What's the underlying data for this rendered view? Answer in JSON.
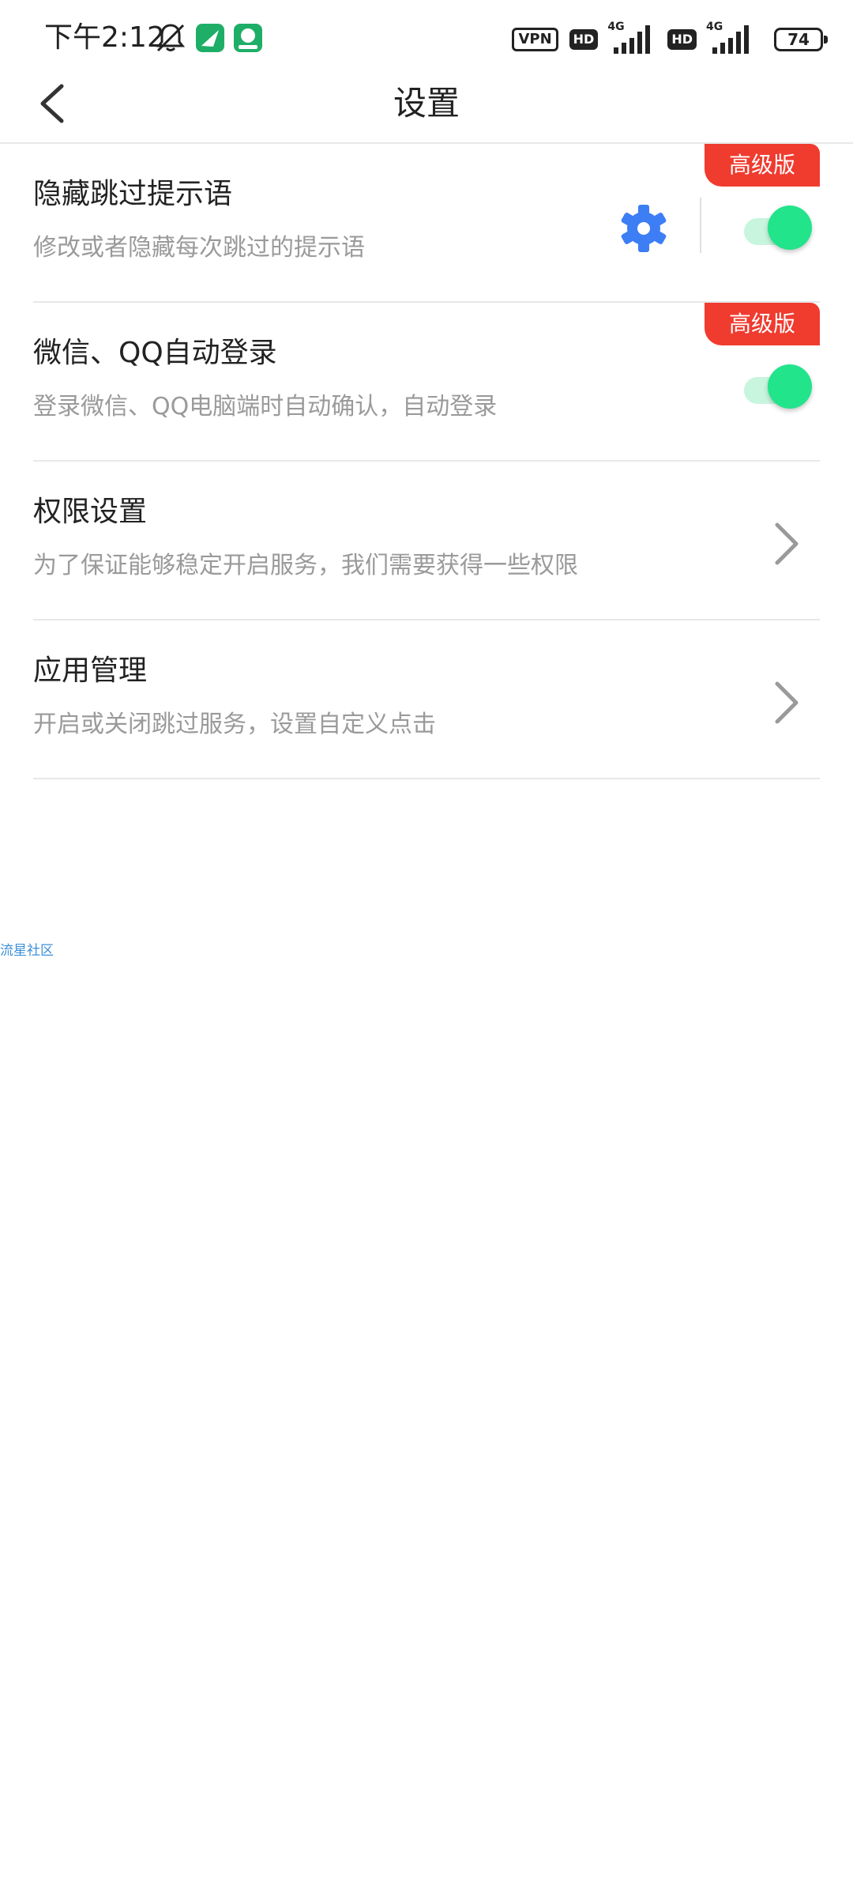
{
  "status_bar": {
    "time": "下午2:12",
    "vpn": "VPN",
    "hd1": "HD",
    "net1": "4G",
    "hd2": "HD",
    "net2": "4G",
    "battery": "74"
  },
  "header": {
    "title": "设置"
  },
  "rows": [
    {
      "title": "隐藏跳过提示语",
      "desc": "修改或者隐藏每次跳过的提示语",
      "badge": "高级版",
      "toggle_on": true
    },
    {
      "title": "微信、QQ自动登录",
      "desc": "登录微信、QQ电脑端时自动确认，自动登录",
      "badge": "高级版",
      "toggle_on": true
    },
    {
      "title": "权限设置",
      "desc": "为了保证能够稳定开启服务，我们需要获得一些权限"
    },
    {
      "title": "应用管理",
      "desc": "开启或关闭跳过服务，设置自定义点击"
    }
  ],
  "watermark": "流星社区",
  "colors": {
    "accent_red": "#f03b2f",
    "toggle_green": "#22e48b",
    "gear_blue": "#3d7ef5",
    "text_primary": "#222222",
    "text_secondary": "#9a9a9a"
  }
}
